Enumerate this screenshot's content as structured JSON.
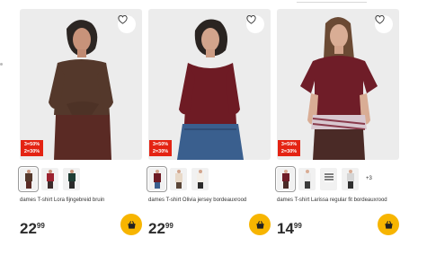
{
  "colors": {
    "promo": "#e42313",
    "cart_button": "#f7b500"
  },
  "products": [
    {
      "name": "dames T-shirt Lora fijngebreid bruin",
      "promo_line1": "3=50%",
      "promo_line2": "2=30%",
      "price_int": "22",
      "price_cents": "99",
      "icons": {
        "favorite": "heart-icon",
        "cart": "basket-icon"
      }
    },
    {
      "name": "dames T-shirt Olivia jersey bordeauxrood",
      "promo_line1": "3=50%",
      "promo_line2": "2=30%",
      "price_int": "22",
      "price_cents": "99",
      "icons": {
        "favorite": "heart-icon",
        "cart": "basket-icon"
      }
    },
    {
      "name": "dames T-shirt Larissa regular fit bordeauxrood",
      "promo_line1": "3=50%",
      "promo_line2": "2=30%",
      "price_int": "14",
      "price_cents": "99",
      "more_colors": "+3",
      "icons": {
        "favorite": "heart-icon",
        "cart": "basket-icon"
      }
    }
  ]
}
